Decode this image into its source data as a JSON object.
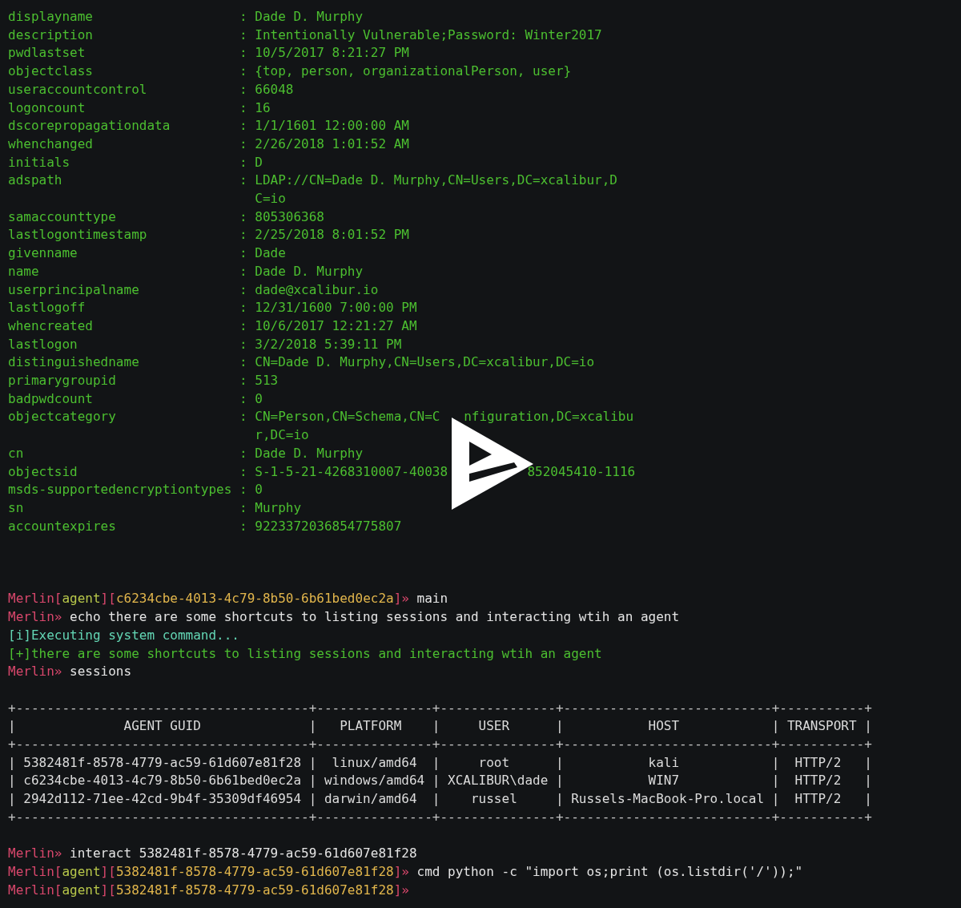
{
  "attributes": [
    {
      "key": "displayname",
      "sep": ":",
      "lines": [
        "Dade D. Murphy"
      ]
    },
    {
      "key": "description",
      "sep": ":",
      "lines": [
        "Intentionally Vulnerable;Password: Winter2017"
      ]
    },
    {
      "key": "pwdlastset",
      "sep": ":",
      "lines": [
        "10/5/2017 8:21:27 PM"
      ]
    },
    {
      "key": "objectclass",
      "sep": ":",
      "lines": [
        "{top, person, organizationalPerson, user}"
      ]
    },
    {
      "key": "useraccountcontrol",
      "sep": ":",
      "lines": [
        "66048"
      ]
    },
    {
      "key": "logoncount",
      "sep": ":",
      "lines": [
        "16"
      ]
    },
    {
      "key": "dscorepropagationdata",
      "sep": ":",
      "lines": [
        "1/1/1601 12:00:00 AM"
      ]
    },
    {
      "key": "whenchanged",
      "sep": ":",
      "lines": [
        "2/26/2018 1:01:52 AM"
      ]
    },
    {
      "key": "initials",
      "sep": ":",
      "lines": [
        "D"
      ]
    },
    {
      "key": "adspath",
      "sep": ":",
      "lines": [
        "LDAP://CN=Dade D. Murphy,CN=Users,DC=xcalibur,D",
        "C=io"
      ]
    },
    {
      "key": "samaccounttype",
      "sep": ":",
      "lines": [
        "805306368"
      ]
    },
    {
      "key": "lastlogontimestamp",
      "sep": ":",
      "lines": [
        "2/25/2018 8:01:52 PM"
      ]
    },
    {
      "key": "givenname",
      "sep": ":",
      "lines": [
        "Dade"
      ]
    },
    {
      "key": "name",
      "sep": ":",
      "lines": [
        "Dade D. Murphy"
      ]
    },
    {
      "key": "userprincipalname",
      "sep": ":",
      "lines": [
        "dade@xcalibur.io"
      ]
    },
    {
      "key": "lastlogoff",
      "sep": ":",
      "lines": [
        "12/31/1600 7:00:00 PM"
      ]
    },
    {
      "key": "whencreated",
      "sep": ":",
      "lines": [
        "10/6/2017 12:21:27 AM"
      ]
    },
    {
      "key": "lastlogon",
      "sep": ":",
      "lines": [
        "3/2/2018 5:39:11 PM"
      ]
    },
    {
      "key": "distinguishedname",
      "sep": ":",
      "lines": [
        "CN=Dade D. Murphy,CN=Users,DC=xcalibur,DC=io"
      ]
    },
    {
      "key": "primarygroupid",
      "sep": ":",
      "lines": [
        "513"
      ]
    },
    {
      "key": "badpwdcount",
      "sep": ":",
      "lines": [
        "0"
      ]
    },
    {
      "key": "objectcategory",
      "sep": ":",
      "lines": [
        [
          "CN=Person,CN=Schema,CN=C",
          "nfiguration,DC=xcalibu"
        ],
        "r,DC=io"
      ]
    },
    {
      "key": "cn",
      "sep": ":",
      "lines": [
        "Dade D. Murphy"
      ]
    },
    {
      "key": "objectsid",
      "sep": ":",
      "lines": [
        [
          "S-1-5-21-4268310007-40038",
          "852045410-1116"
        ]
      ]
    },
    {
      "key": "msds-supportedencryptiontypes",
      "sep": ":",
      "lines": [
        "0"
      ]
    },
    {
      "key": "sn",
      "sep": ":",
      "lines": [
        "Murphy"
      ]
    },
    {
      "key": "accountexpires",
      "sep": ":",
      "lines": [
        "9223372036854775807"
      ]
    }
  ],
  "session_log": [
    {
      "segments": [
        {
          "kind": "prompt",
          "text": "Merlin["
        },
        {
          "kind": "agent",
          "text": "agent"
        },
        {
          "kind": "prompt",
          "text": "]["
        },
        {
          "kind": "guid",
          "text": "c6234cbe-4013-4c79-8b50-6b61bed0ec2a"
        },
        {
          "kind": "prompt",
          "text": "]»"
        },
        {
          "kind": "command",
          "text": " main"
        }
      ]
    },
    {
      "segments": [
        {
          "kind": "prompt",
          "text": "Merlin»"
        },
        {
          "kind": "command",
          "text": " echo there are some shortcuts to listing sessions and interacting wtih an agent"
        }
      ]
    },
    {
      "segments": [
        {
          "kind": "info",
          "text": "[i]Executing system command..."
        }
      ]
    },
    {
      "segments": [
        {
          "kind": "success",
          "text": "[+]there are some shortcuts to listing sessions and interacting wtih an agent"
        }
      ]
    },
    {
      "segments": [
        {
          "kind": "prompt",
          "text": "Merlin»"
        },
        {
          "kind": "command",
          "text": " sessions"
        }
      ]
    }
  ],
  "sessions_table": [
    {
      "kind": "border",
      "text": "+--------------------------------------+---------------+---------------+---------------------------+-----------+"
    },
    {
      "kind": "row",
      "text": "|              AGENT GUID              |   PLATFORM    |     USER      |           HOST            | TRANSPORT |"
    },
    {
      "kind": "border",
      "text": "+--------------------------------------+---------------+---------------+---------------------------+-----------+"
    },
    {
      "kind": "row",
      "text": "| 5382481f-8578-4779-ac59-61d607e81f28 |  linux/amd64  |     root      |           kali            |  HTTP/2   |"
    },
    {
      "kind": "row",
      "text": "| c6234cbe-4013-4c79-8b50-6b61bed0ec2a | windows/amd64 | XCALIBUR\\dade |           WIN7            |  HTTP/2   |"
    },
    {
      "kind": "row",
      "text": "| 2942d112-71ee-42cd-9b4f-35309df46954 | darwin/amd64  |    russel     | Russels-MacBook-Pro.local |  HTTP/2   |"
    },
    {
      "kind": "border",
      "text": "+--------------------------------------+---------------+---------------+---------------------------+-----------+"
    }
  ],
  "interaction_log": [
    {
      "segments": [
        {
          "kind": "prompt",
          "text": "Merlin»"
        },
        {
          "kind": "command",
          "text": " interact 5382481f-8578-4779-ac59-61d607e81f28"
        }
      ]
    },
    {
      "segments": [
        {
          "kind": "prompt",
          "text": "Merlin["
        },
        {
          "kind": "agent",
          "text": "agent"
        },
        {
          "kind": "prompt",
          "text": "]["
        },
        {
          "kind": "guid",
          "text": "5382481f-8578-4779-ac59-61d607e81f28"
        },
        {
          "kind": "prompt",
          "text": "]»"
        },
        {
          "kind": "command",
          "text": " cmd python -c \"import os;print (os.listdir('/'));\""
        }
      ]
    },
    {
      "segments": [
        {
          "kind": "prompt",
          "text": "Merlin["
        },
        {
          "kind": "agent",
          "text": "agent"
        },
        {
          "kind": "prompt",
          "text": "]["
        },
        {
          "kind": "guid",
          "text": "5382481f-8578-4779-ac59-61d607e81f28"
        },
        {
          "kind": "prompt",
          "text": "]»"
        }
      ]
    }
  ]
}
